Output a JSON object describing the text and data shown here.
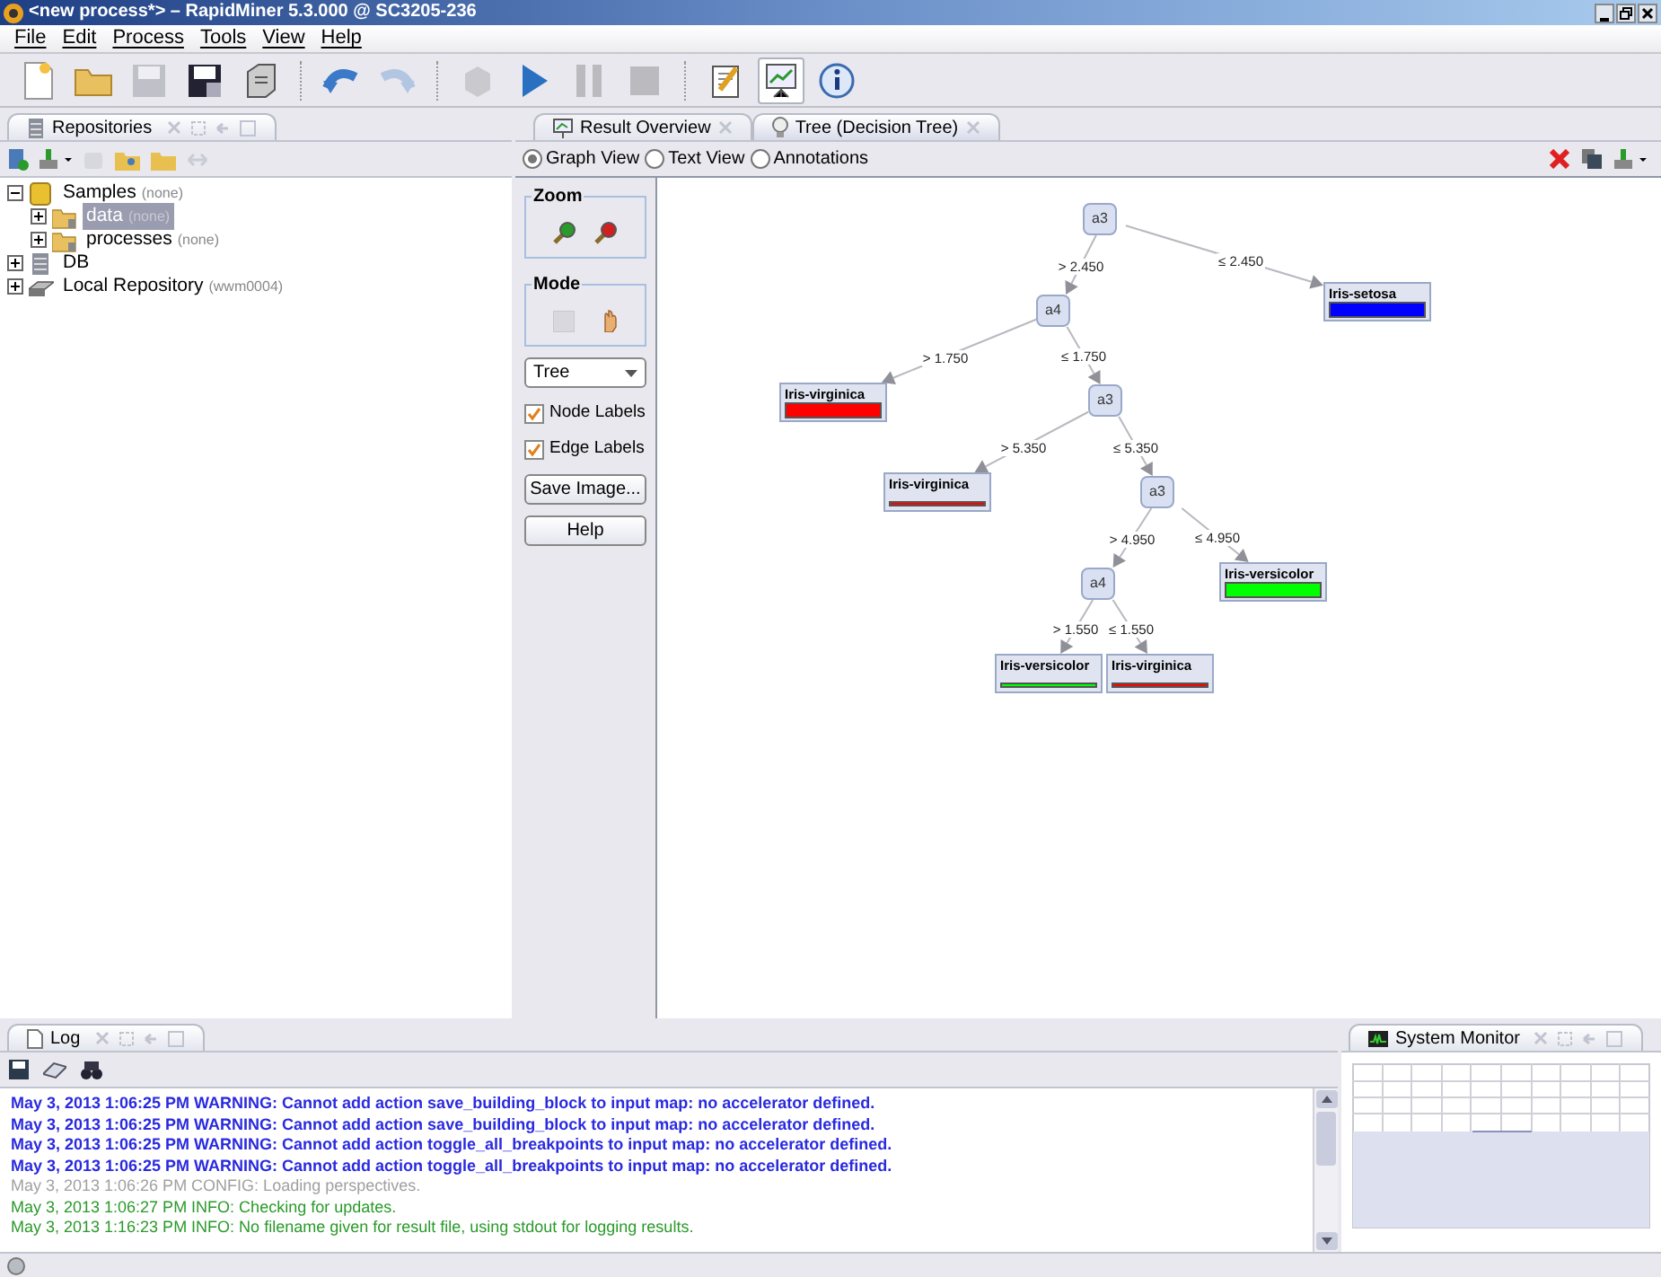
{
  "window": {
    "title": "<new process*> – RapidMiner 5.3.000 @ SC3205-236"
  },
  "menu": [
    "File",
    "Edit",
    "Process",
    "Tools",
    "View",
    "Help"
  ],
  "toolbar": [
    {
      "kind": "new",
      "disabled": false,
      "selected": false
    },
    {
      "kind": "open",
      "disabled": false,
      "selected": false
    },
    {
      "kind": "save",
      "disabled": true,
      "selected": false
    },
    {
      "kind": "save-as",
      "disabled": false,
      "selected": false
    },
    {
      "kind": "print",
      "disabled": false,
      "selected": false
    },
    {
      "kind": "sep"
    },
    {
      "kind": "undo",
      "disabled": false,
      "selected": false
    },
    {
      "kind": "redo",
      "disabled": true,
      "selected": false
    },
    {
      "kind": "sep"
    },
    {
      "kind": "cube",
      "disabled": true,
      "selected": false
    },
    {
      "kind": "run",
      "disabled": false,
      "selected": false
    },
    {
      "kind": "pause",
      "disabled": true,
      "selected": false
    },
    {
      "kind": "stop",
      "disabled": true,
      "selected": false
    },
    {
      "kind": "sep"
    },
    {
      "kind": "design",
      "disabled": false,
      "selected": false
    },
    {
      "kind": "results",
      "disabled": false,
      "selected": true
    },
    {
      "kind": "info",
      "disabled": false,
      "selected": false
    }
  ],
  "repositories": {
    "title": "Repositories",
    "tree": [
      {
        "label": "Samples",
        "note": "(none)",
        "kind": "jar",
        "expanded": true,
        "selected": false,
        "children": [
          {
            "label": "data",
            "note": "(none)",
            "kind": "folder",
            "expanded": false,
            "selected": true
          },
          {
            "label": "processes",
            "note": "(none)",
            "kind": "folder",
            "expanded": false,
            "selected": false
          }
        ]
      },
      {
        "label": "DB",
        "kind": "database",
        "expanded": false,
        "selected": false
      },
      {
        "label": "Local Repository",
        "note": "(wwm0004)",
        "kind": "drive",
        "expanded": false,
        "selected": false
      }
    ]
  },
  "results": {
    "tabs": [
      {
        "label": "Result Overview",
        "selected": false
      },
      {
        "label": "Tree (Decision Tree)",
        "selected": true
      }
    ],
    "views": [
      {
        "label": "Graph View",
        "selected": true
      },
      {
        "label": "Text View",
        "selected": false
      },
      {
        "label": "Annotations",
        "selected": false
      }
    ],
    "zoom_label": "Zoom",
    "mode_label": "Mode",
    "layout_select": "Tree",
    "checkboxes": [
      {
        "label": "Node Labels",
        "checked": true
      },
      {
        "label": "Edge Labels",
        "checked": true
      }
    ],
    "buttons": [
      "Save Image...",
      "Help"
    ],
    "tree": {
      "label": "a3",
      "children": [
        {
          "edge": "> 2.450",
          "node": {
            "label": "a4",
            "children": [
              {
                "edge": "> 1.750",
                "node": {
                  "label": "Iris-virginica",
                  "color": "#ff0000",
                  "kind": "thick"
                }
              },
              {
                "edge": "≤ 1.750",
                "node": {
                  "label": "a3",
                  "children": [
                    {
                      "edge": "> 5.350",
                      "node": {
                        "label": "Iris-virginica",
                        "color": "#ff0000",
                        "kind": "thin"
                      }
                    },
                    {
                      "edge": "≤ 5.350",
                      "node": {
                        "label": "a3",
                        "children": [
                          {
                            "edge": "> 4.950",
                            "node": {
                              "label": "a4",
                              "children": [
                                {
                                  "edge": "> 1.550",
                                  "node": {
                                    "label": "Iris-versicolor",
                                    "color": "#00ff00",
                                    "kind": "thin"
                                  }
                                },
                                {
                                  "edge": "≤ 1.550",
                                  "node": {
                                    "label": "Iris-virginica",
                                    "color": "#ff0000",
                                    "kind": "thin"
                                  }
                                }
                              ]
                            }
                          },
                          {
                            "edge": "≤ 4.950",
                            "node": {
                              "label": "Iris-versicolor",
                              "color": "#00ff00",
                              "kind": "thick"
                            }
                          }
                        ]
                      }
                    }
                  ]
                }
              }
            ]
          }
        },
        {
          "edge": "≤ 2.450",
          "node": {
            "label": "Iris-setosa",
            "color": "#0000ff",
            "kind": "thick"
          }
        }
      ]
    }
  },
  "log": {
    "title": "Log",
    "lines": [
      {
        "kind": "warning",
        "text": "May 3, 2013 1:06:25 PM WARNING: Cannot add action save_building_block to input map: no accelerator defined."
      },
      {
        "kind": "warning",
        "text": "May 3, 2013 1:06:25 PM WARNING: Cannot add action save_building_block to input map: no accelerator defined."
      },
      {
        "kind": "warning",
        "text": "May 3, 2013 1:06:25 PM WARNING: Cannot add action toggle_all_breakpoints to input map: no accelerator defined."
      },
      {
        "kind": "warning",
        "text": "May 3, 2013 1:06:25 PM WARNING: Cannot add action toggle_all_breakpoints to input map: no accelerator defined."
      },
      {
        "kind": "config",
        "text": "May 3, 2013 1:06:26 PM CONFIG: Loading perspectives."
      },
      {
        "kind": "info",
        "text": "May 3, 2013 1:06:27 PM INFO: Checking for updates."
      },
      {
        "kind": "info",
        "text": "May 3, 2013 1:16:23 PM INFO: No filename given for result file, using stdout for logging results."
      }
    ]
  },
  "system_monitor": {
    "title": "System Monitor"
  }
}
